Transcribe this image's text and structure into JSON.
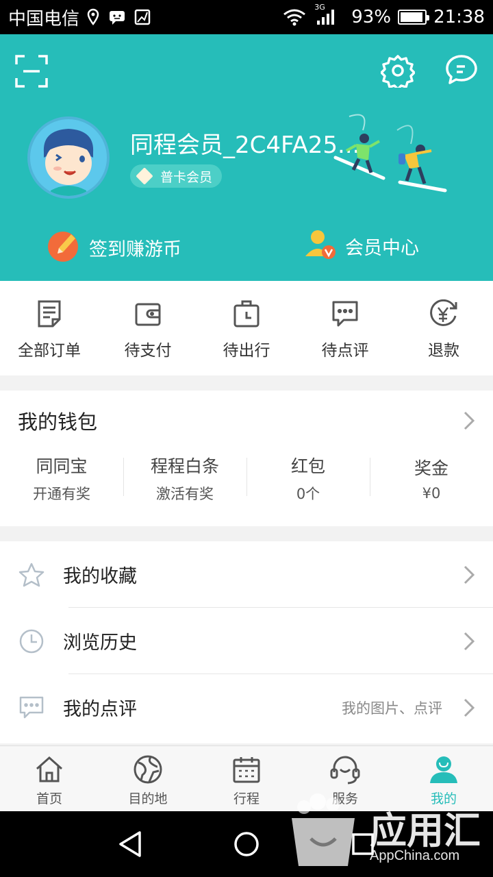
{
  "status_bar": {
    "carrier": "中国电信",
    "signal_type": "3G",
    "battery": "93%",
    "battery_level": 0.93,
    "time": "21:38"
  },
  "header": {
    "username": "同程会员_2C4FA25...",
    "member_level": "普卡会员",
    "checkin_label": "签到赚游币",
    "member_center_label": "会员中心",
    "bg_color": "#26bdb9"
  },
  "orders": [
    {
      "label": "全部订单",
      "icon": "order-list-icon"
    },
    {
      "label": "待支付",
      "icon": "wallet-icon"
    },
    {
      "label": "待出行",
      "icon": "luggage-icon"
    },
    {
      "label": "待点评",
      "icon": "comment-icon"
    },
    {
      "label": "退款",
      "icon": "refund-icon"
    }
  ],
  "wallet": {
    "title": "我的钱包",
    "cells": [
      {
        "title": "同同宝",
        "sub": "开通有奖"
      },
      {
        "title": "程程白条",
        "sub": "激活有奖"
      },
      {
        "title": "红包",
        "sub": "0个"
      },
      {
        "title": "奖金",
        "sub": "¥0"
      }
    ]
  },
  "list": [
    {
      "label": "我的收藏",
      "icon": "star-icon",
      "extra": ""
    },
    {
      "label": "浏览历史",
      "icon": "clock-icon",
      "extra": ""
    },
    {
      "label": "我的点评",
      "icon": "comment-icon",
      "extra": "我的图片、点评"
    }
  ],
  "tabs": [
    {
      "label": "首页",
      "icon": "home-icon"
    },
    {
      "label": "目的地",
      "icon": "globe-icon"
    },
    {
      "label": "行程",
      "icon": "calendar-icon"
    },
    {
      "label": "服务",
      "icon": "headset-icon"
    },
    {
      "label": "我的",
      "icon": "profile-icon",
      "active": true
    }
  ],
  "watermark": {
    "text": "应用汇",
    "sub": "AppChina.com"
  }
}
